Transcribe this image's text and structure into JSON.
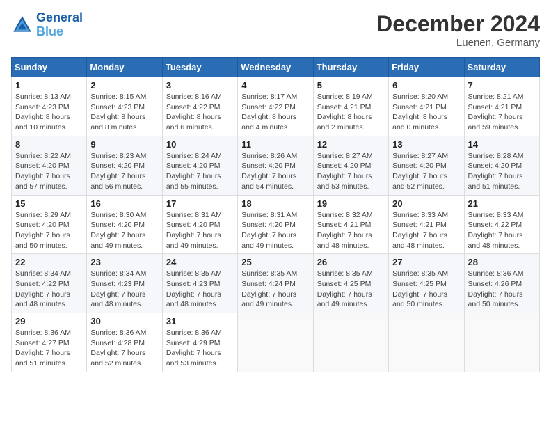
{
  "logo": {
    "line1": "General",
    "line2": "Blue"
  },
  "title": "December 2024",
  "location": "Luenen, Germany",
  "weekdays": [
    "Sunday",
    "Monday",
    "Tuesday",
    "Wednesday",
    "Thursday",
    "Friday",
    "Saturday"
  ],
  "weeks": [
    [
      {
        "day": "1",
        "info": "Sunrise: 8:13 AM\nSunset: 4:23 PM\nDaylight: 8 hours\nand 10 minutes."
      },
      {
        "day": "2",
        "info": "Sunrise: 8:15 AM\nSunset: 4:23 PM\nDaylight: 8 hours\nand 8 minutes."
      },
      {
        "day": "3",
        "info": "Sunrise: 8:16 AM\nSunset: 4:22 PM\nDaylight: 8 hours\nand 6 minutes."
      },
      {
        "day": "4",
        "info": "Sunrise: 8:17 AM\nSunset: 4:22 PM\nDaylight: 8 hours\nand 4 minutes."
      },
      {
        "day": "5",
        "info": "Sunrise: 8:19 AM\nSunset: 4:21 PM\nDaylight: 8 hours\nand 2 minutes."
      },
      {
        "day": "6",
        "info": "Sunrise: 8:20 AM\nSunset: 4:21 PM\nDaylight: 8 hours\nand 0 minutes."
      },
      {
        "day": "7",
        "info": "Sunrise: 8:21 AM\nSunset: 4:21 PM\nDaylight: 7 hours\nand 59 minutes."
      }
    ],
    [
      {
        "day": "8",
        "info": "Sunrise: 8:22 AM\nSunset: 4:20 PM\nDaylight: 7 hours\nand 57 minutes."
      },
      {
        "day": "9",
        "info": "Sunrise: 8:23 AM\nSunset: 4:20 PM\nDaylight: 7 hours\nand 56 minutes."
      },
      {
        "day": "10",
        "info": "Sunrise: 8:24 AM\nSunset: 4:20 PM\nDaylight: 7 hours\nand 55 minutes."
      },
      {
        "day": "11",
        "info": "Sunrise: 8:26 AM\nSunset: 4:20 PM\nDaylight: 7 hours\nand 54 minutes."
      },
      {
        "day": "12",
        "info": "Sunrise: 8:27 AM\nSunset: 4:20 PM\nDaylight: 7 hours\nand 53 minutes."
      },
      {
        "day": "13",
        "info": "Sunrise: 8:27 AM\nSunset: 4:20 PM\nDaylight: 7 hours\nand 52 minutes."
      },
      {
        "day": "14",
        "info": "Sunrise: 8:28 AM\nSunset: 4:20 PM\nDaylight: 7 hours\nand 51 minutes."
      }
    ],
    [
      {
        "day": "15",
        "info": "Sunrise: 8:29 AM\nSunset: 4:20 PM\nDaylight: 7 hours\nand 50 minutes."
      },
      {
        "day": "16",
        "info": "Sunrise: 8:30 AM\nSunset: 4:20 PM\nDaylight: 7 hours\nand 49 minutes."
      },
      {
        "day": "17",
        "info": "Sunrise: 8:31 AM\nSunset: 4:20 PM\nDaylight: 7 hours\nand 49 minutes."
      },
      {
        "day": "18",
        "info": "Sunrise: 8:31 AM\nSunset: 4:20 PM\nDaylight: 7 hours\nand 49 minutes."
      },
      {
        "day": "19",
        "info": "Sunrise: 8:32 AM\nSunset: 4:21 PM\nDaylight: 7 hours\nand 48 minutes."
      },
      {
        "day": "20",
        "info": "Sunrise: 8:33 AM\nSunset: 4:21 PM\nDaylight: 7 hours\nand 48 minutes."
      },
      {
        "day": "21",
        "info": "Sunrise: 8:33 AM\nSunset: 4:22 PM\nDaylight: 7 hours\nand 48 minutes."
      }
    ],
    [
      {
        "day": "22",
        "info": "Sunrise: 8:34 AM\nSunset: 4:22 PM\nDaylight: 7 hours\nand 48 minutes."
      },
      {
        "day": "23",
        "info": "Sunrise: 8:34 AM\nSunset: 4:23 PM\nDaylight: 7 hours\nand 48 minutes."
      },
      {
        "day": "24",
        "info": "Sunrise: 8:35 AM\nSunset: 4:23 PM\nDaylight: 7 hours\nand 48 minutes."
      },
      {
        "day": "25",
        "info": "Sunrise: 8:35 AM\nSunset: 4:24 PM\nDaylight: 7 hours\nand 49 minutes."
      },
      {
        "day": "26",
        "info": "Sunrise: 8:35 AM\nSunset: 4:25 PM\nDaylight: 7 hours\nand 49 minutes."
      },
      {
        "day": "27",
        "info": "Sunrise: 8:35 AM\nSunset: 4:25 PM\nDaylight: 7 hours\nand 50 minutes."
      },
      {
        "day": "28",
        "info": "Sunrise: 8:36 AM\nSunset: 4:26 PM\nDaylight: 7 hours\nand 50 minutes."
      }
    ],
    [
      {
        "day": "29",
        "info": "Sunrise: 8:36 AM\nSunset: 4:27 PM\nDaylight: 7 hours\nand 51 minutes."
      },
      {
        "day": "30",
        "info": "Sunrise: 8:36 AM\nSunset: 4:28 PM\nDaylight: 7 hours\nand 52 minutes."
      },
      {
        "day": "31",
        "info": "Sunrise: 8:36 AM\nSunset: 4:29 PM\nDaylight: 7 hours\nand 53 minutes."
      },
      null,
      null,
      null,
      null
    ]
  ]
}
